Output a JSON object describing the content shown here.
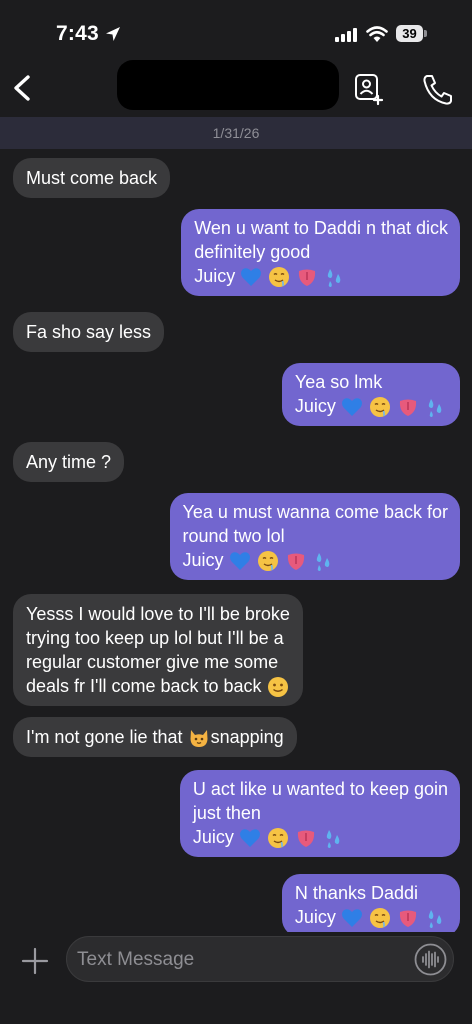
{
  "status_bar": {
    "time": "7:43",
    "battery": "39"
  },
  "header": {
    "contact_name": ""
  },
  "conversation": {
    "date": "1/31/26",
    "messages": [
      {
        "id": 1,
        "direction": "incoming",
        "lines": [
          "Must come back"
        ],
        "emojis": []
      },
      {
        "id": 2,
        "direction": "outgoing",
        "lines": [
          "Wen u want to Daddi n that dick",
          "definitely good",
          "Juicy"
        ],
        "emojis": [
          "blue-heart",
          "drooling-face",
          "tongue",
          "sweat-droplets"
        ]
      },
      {
        "id": 3,
        "direction": "incoming",
        "lines": [
          "Fa sho say less"
        ],
        "emojis": []
      },
      {
        "id": 4,
        "direction": "outgoing",
        "lines": [
          "Yea so lmk",
          "Juicy"
        ],
        "emojis": [
          "blue-heart",
          "drooling-face",
          "tongue",
          "sweat-droplets"
        ]
      },
      {
        "id": 5,
        "direction": "incoming",
        "lines": [
          "Any time ?"
        ],
        "emojis": []
      },
      {
        "id": 6,
        "direction": "outgoing",
        "lines": [
          "Yea u must wanna come back for",
          "round two lol",
          "Juicy"
        ],
        "emojis": [
          "blue-heart",
          "drooling-face",
          "tongue",
          "sweat-droplets"
        ]
      },
      {
        "id": 7,
        "direction": "incoming",
        "lines": [
          "Yesss I would love to I'll be broke",
          "trying too keep up lol but I'll be a",
          "regular customer give me some",
          "deals fr I'll come back to back"
        ],
        "emojis": [
          "slightly-smiling-face"
        ]
      },
      {
        "id": 8,
        "direction": "incoming",
        "lines": [
          "I'm not gone lie that",
          "snapping"
        ],
        "emojis": [
          "cat-face"
        ]
      },
      {
        "id": 9,
        "direction": "outgoing",
        "lines": [
          "U act like u wanted to keep goin",
          "just then",
          "Juicy"
        ],
        "emojis": [
          "blue-heart",
          "drooling-face",
          "tongue",
          "sweat-droplets"
        ]
      },
      {
        "id": 10,
        "direction": "outgoing",
        "lines": [
          "N thanks Daddi",
          "Juicy"
        ],
        "emojis": [
          "blue-heart",
          "drooling-face",
          "tongue",
          "sweat-droplets"
        ]
      }
    ]
  },
  "composer": {
    "placeholder": "Text Message"
  },
  "colors": {
    "background": "#1c1c1e",
    "incoming_bubble": "#3a3a3c",
    "outgoing_bubble": "#7266cf",
    "date_bar": "#2c2c3a"
  },
  "icons": [
    "location-arrow-icon",
    "signal-icon",
    "wifi-icon",
    "battery-icon",
    "back-chevron-icon",
    "contact-card-icon",
    "phone-icon",
    "plus-icon",
    "audio-waveform-icon"
  ]
}
